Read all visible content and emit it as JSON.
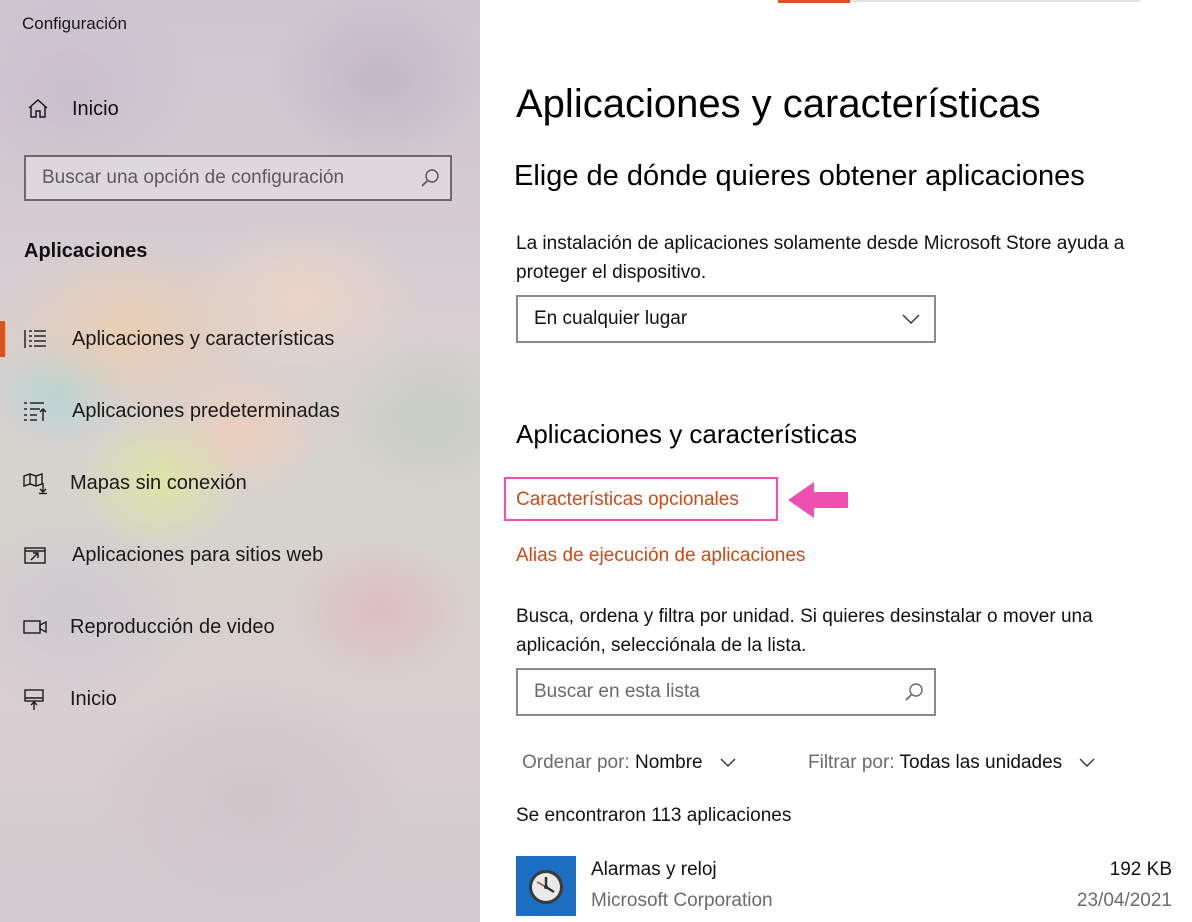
{
  "window": {
    "title": "Configuración"
  },
  "sidebar": {
    "home_label": "Inicio",
    "search_placeholder": "Buscar una opción de configuración",
    "section_title": "Aplicaciones",
    "items": [
      {
        "label": "Aplicaciones y características",
        "icon": "apps-features-list-icon",
        "selected": true
      },
      {
        "label": "Aplicaciones predeterminadas",
        "icon": "default-apps-icon",
        "selected": false
      },
      {
        "label": "Mapas sin conexión",
        "icon": "offline-map-icon",
        "selected": false
      },
      {
        "label": "Aplicaciones para sitios web",
        "icon": "apps-for-websites-icon",
        "selected": false
      },
      {
        "label": "Reproducción de video",
        "icon": "video-camera-icon",
        "selected": false
      },
      {
        "label": "Inicio",
        "icon": "startup-icon",
        "selected": false
      }
    ]
  },
  "main": {
    "title": "Aplicaciones y características",
    "source_heading": "Elige de dónde quieres obtener aplicaciones",
    "source_description": "La instalación de aplicaciones solamente desde Microsoft Store ayuda a proteger el dispositivo.",
    "source_dropdown_value": "En cualquier lugar",
    "apps_heading": "Aplicaciones y características",
    "optional_features_link": "Características opcionales",
    "app_execution_alias_link": "Alias de ejecución de aplicaciones",
    "apps_description": "Busca, ordena y filtra por unidad. Si quieres desinstalar o mover una aplicación, selecciónala de la lista.",
    "list_search_placeholder": "Buscar en esta lista",
    "sort_label": "Ordenar por:",
    "sort_value": "Nombre",
    "filter_label": "Filtrar por:",
    "filter_value": "Todas las unidades",
    "results_count": "Se encontraron 113 aplicaciones",
    "apps": [
      {
        "name": "Alarmas y reloj",
        "publisher": "Microsoft Corporation",
        "size": "192 KB",
        "date": "23/04/2021",
        "icon": "alarm-clock-icon"
      }
    ]
  },
  "colors": {
    "accent": "#d9531e",
    "link": "#cc4a17",
    "highlight_box": "#ee4fb1",
    "app_tile": "#1b6ec2"
  }
}
